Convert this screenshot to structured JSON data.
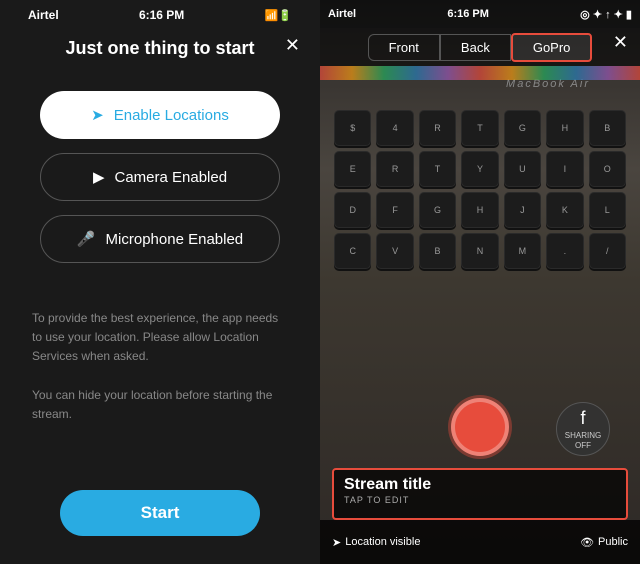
{
  "left": {
    "status": {
      "carrier": "Airtel",
      "time": "6:16 PM",
      "signal": "●●●●",
      "wifi": "wifi",
      "battery": "▮"
    },
    "title": "Just one thing to start",
    "close_label": "✕",
    "buttons": [
      {
        "id": "locations",
        "icon": "➤",
        "label": "Enable Locations",
        "style": "active"
      },
      {
        "id": "camera",
        "icon": "📹",
        "label": "Camera Enabled",
        "style": "enabled"
      },
      {
        "id": "microphone",
        "icon": "🎤",
        "label": "Microphone Enabled",
        "style": "enabled"
      }
    ],
    "description": "To provide the best experience, the app needs to use your location. Please allow Location Services when asked.\n\nYou can hide your location before starting the stream.",
    "start_label": "Start"
  },
  "right": {
    "status": {
      "carrier": "Airtel",
      "time": "6:16 PM",
      "icons": "◎ ⊕ ↑ ✦ ▮"
    },
    "tabs": [
      {
        "id": "front",
        "label": "Front"
      },
      {
        "id": "back",
        "label": "Back"
      },
      {
        "id": "gopro",
        "label": "GoPro",
        "selected": true
      }
    ],
    "close_label": "✕",
    "macbook_label": "MacBook Air",
    "keyboard_rows": [
      [
        "$",
        "4",
        "R",
        "T",
        "G",
        "H",
        "B"
      ],
      [
        "E",
        "R",
        "T",
        "Y",
        "U",
        "I",
        "O"
      ],
      [
        "D",
        "F",
        "G",
        "H",
        "J",
        "K",
        "L"
      ],
      [
        "C",
        "V",
        "B",
        "N",
        "M",
        ".",
        "/"
      ]
    ],
    "sharing": {
      "icon": "f",
      "label": "SHARING OFF"
    },
    "stream_title": "Stream title",
    "stream_title_sub": "TAP TO EDIT",
    "location_label": "Location visible",
    "public_label": "Public"
  }
}
